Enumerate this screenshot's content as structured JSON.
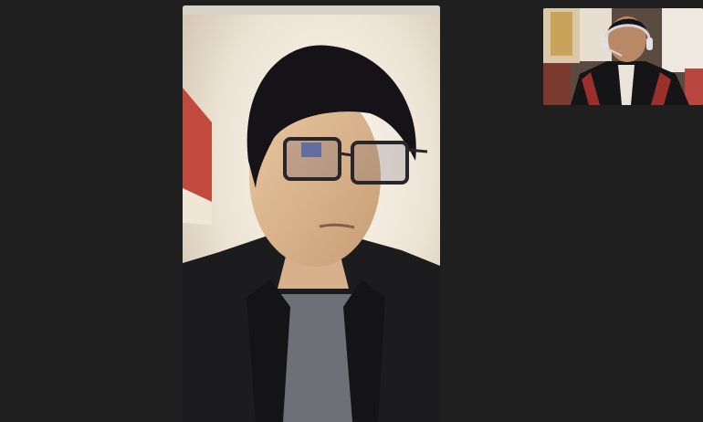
{
  "call": {
    "remote_feed": {
      "description_icon": "video-feed-icon"
    },
    "self_feed": {
      "description_icon": "self-view-icon"
    }
  },
  "colors": {
    "background": "#201f1f",
    "main_wall": "#efe8dc",
    "accent_wall": "#c0473b",
    "jacket": "#1d1c1e",
    "shirt": "#6f7078"
  }
}
